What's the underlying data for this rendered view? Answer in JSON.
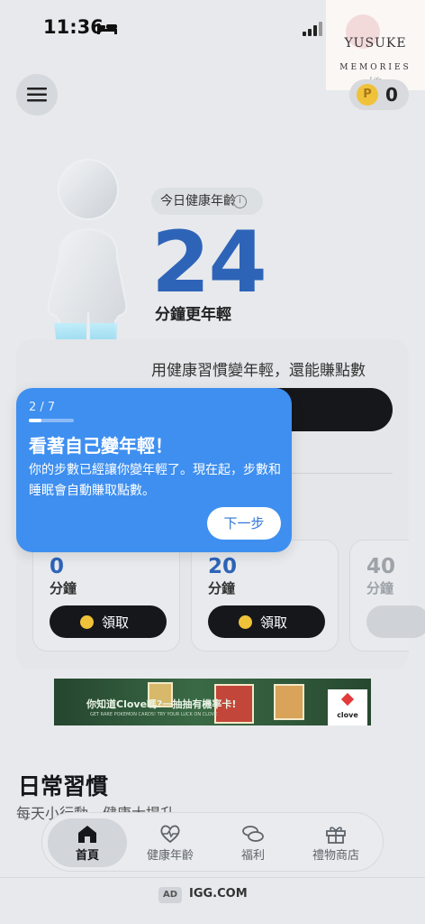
{
  "status_bar": {
    "time": "11:36"
  },
  "watermark": {
    "title": "YUSUKE",
    "subtitle": "MEMORIES",
    "signature": "Life"
  },
  "coins": {
    "icon_letter": "P",
    "count": "0"
  },
  "health_age": {
    "label": "今日健康年齡",
    "info_icon": "i",
    "value": "24",
    "unit": "分鐘更年輕"
  },
  "card": {
    "heading": "用健康習慣變年輕，還能賺點數",
    "rewards": [
      {
        "value": "0",
        "unit": "分鐘",
        "button": "領取"
      },
      {
        "value": "20",
        "unit": "分鐘",
        "button": "領取"
      },
      {
        "value": "40",
        "unit": "分鐘"
      }
    ]
  },
  "tooltip": {
    "progress": "2 / 7",
    "progress_fraction": 0.2857,
    "title": "看著自己變年輕！",
    "body": "你的步數已經讓你變年輕了。現在起，步數和睡眠會自動賺取點數。",
    "next_button": "下一步"
  },
  "ad_banner": {
    "headline": "你知道Clove嗎?一抽抽有機率卡!",
    "subline": "GET RARE POKEMON CARDS! TRY YOUR LUCK ON CLOVE",
    "logo": "clove"
  },
  "section": {
    "title": "日常習慣",
    "subtitle": "每天小行動，健康大提升"
  },
  "bottom_nav": {
    "items": [
      {
        "label": "首頁",
        "icon": "home-icon",
        "active": true
      },
      {
        "label": "健康年齡",
        "icon": "heart-pulse-icon",
        "active": false
      },
      {
        "label": "福利",
        "icon": "coins-icon",
        "active": false
      },
      {
        "label": "禮物商店",
        "icon": "gift-icon",
        "active": false
      }
    ]
  },
  "footer_ad": {
    "tag": "AD",
    "domain": "IGG.COM"
  },
  "colors": {
    "accent_blue": "#3e8ff0",
    "age_blue": "#2e64b8",
    "dark_button": "#16171b",
    "coin_gold": "#f0c23a"
  }
}
